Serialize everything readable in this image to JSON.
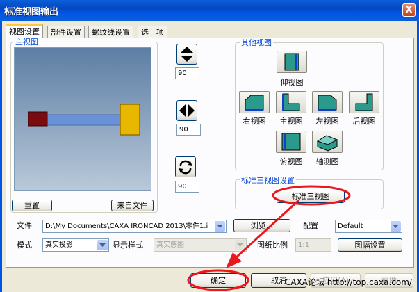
{
  "window": {
    "title": "标准视图输出",
    "close_glyph": "X"
  },
  "tabs": [
    {
      "label": "视图设置",
      "active": true
    },
    {
      "label": "部件设置"
    },
    {
      "label": "螺纹线设置"
    },
    {
      "label": "选　项"
    }
  ],
  "main_view": {
    "group_label": "主视图",
    "reset_label": "重置",
    "from_file_label": "来自文件"
  },
  "rotate": {
    "vertical": {
      "icon": "up-down-arrows-icon",
      "value": "90"
    },
    "horizontal": {
      "icon": "left-right-arrows-icon",
      "value": "90"
    },
    "spin": {
      "icon": "rotate-arrows-icon",
      "value": "90"
    }
  },
  "other_views": {
    "group_label": "其他视图",
    "items": {
      "bottom": "仰视图",
      "right": "右视图",
      "front": "主视图",
      "left": "左视图",
      "back": "后视图",
      "top": "俯视图",
      "axon": "轴测图"
    }
  },
  "standard3": {
    "group_label": "标准三视图设置",
    "button_label": "标准三视图"
  },
  "file": {
    "label": "文件",
    "value": "D:\\My Documents\\CAXA IRONCAD 2013\\零件1.i",
    "browse_label": "浏览...",
    "config_label": "配置",
    "config_value": "Default"
  },
  "mode": {
    "label": "模式",
    "value": "真实投影",
    "style_label": "显示样式",
    "style_value": "真实感图",
    "scale_label": "图纸比例",
    "scale_value": "1:1",
    "sheet_button": "图幅设置"
  },
  "footer": {
    "ok": "确定",
    "cancel": "取消",
    "apply": "应用(A)",
    "help": "帮助",
    "watermark": "CAXA论坛 http://top.caxa.com/"
  },
  "colors": {
    "title_bar": "#0054e3",
    "highlight": "#e8181c",
    "viewport_top": "#5d7ea4",
    "rod": "#6a90d8",
    "left_block": "#7a0b10",
    "right_block": "#e8b700"
  }
}
